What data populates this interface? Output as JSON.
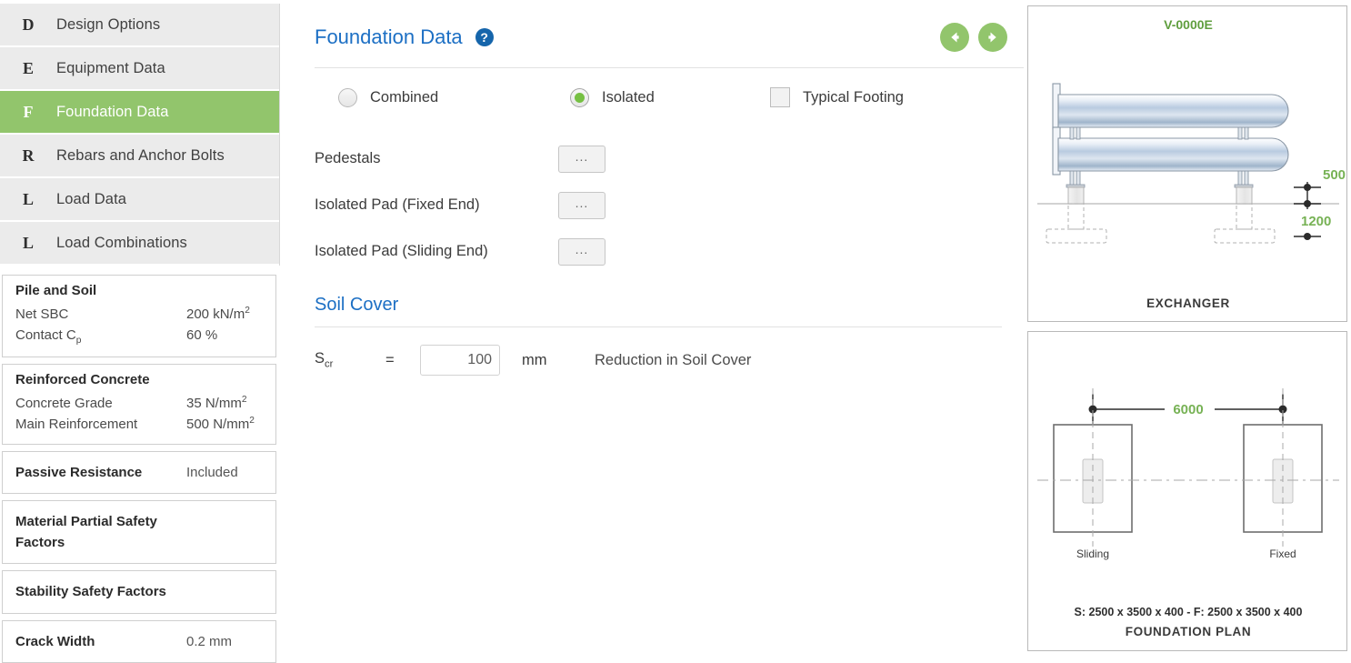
{
  "sidebar": {
    "nav_items": [
      {
        "key": "D",
        "label": "Design Options",
        "active": false
      },
      {
        "key": "E",
        "label": "Equipment Data",
        "active": false
      },
      {
        "key": "F",
        "label": "Foundation Data",
        "active": true
      },
      {
        "key": "R",
        "label": "Rebars and Anchor Bolts",
        "active": false
      },
      {
        "key": "L",
        "label": "Load Data",
        "active": false
      },
      {
        "key": "L",
        "label": "Load Combinations",
        "active": false
      }
    ],
    "cards": [
      {
        "title": "Pile and Soil",
        "rows": [
          {
            "key": "Net SBC",
            "value": "200 kN/m",
            "sup": "2"
          },
          {
            "key": "Contact C",
            "key_sub": "p",
            "value": "60 %",
            "sup": ""
          }
        ]
      },
      {
        "title": "Reinforced Concrete",
        "rows": [
          {
            "key": "Concrete Grade",
            "value": "35 N/mm",
            "sup": "2"
          },
          {
            "key": "Main Reinforcement",
            "value": "500 N/mm",
            "sup": "2"
          }
        ]
      }
    ],
    "compact_cards": [
      {
        "key": "Passive Resistance",
        "value": "Included"
      },
      {
        "key": "Material Partial Safety Factors",
        "value": ""
      },
      {
        "key": "Stability Safety Factors",
        "value": ""
      },
      {
        "key": "Crack Width",
        "value": "0.2 mm"
      }
    ]
  },
  "header": {
    "title": "Foundation Data",
    "help_icon": "question-mark-icon",
    "prev_label": "back-arrow-icon",
    "next_label": "forward-arrow-icon"
  },
  "options": {
    "combined": {
      "label": "Combined",
      "selected": false
    },
    "isolated": {
      "label": "Isolated",
      "selected": true
    },
    "typical_footing": {
      "label": "Typical Footing",
      "checked": false
    }
  },
  "fields": [
    {
      "label": "Pedestals",
      "button": "..."
    },
    {
      "label": "Isolated Pad (Fixed End)",
      "button": "..."
    },
    {
      "label": "Isolated Pad (Sliding End)",
      "button": "..."
    }
  ],
  "soil_cover": {
    "section_title": "Soil Cover",
    "symbol": "S",
    "symbol_sub": "cr",
    "equals": "=",
    "value": "100",
    "placeholder": "0",
    "unit": "mm",
    "description": "Reduction in Soil Cover"
  },
  "diagrams": {
    "elevation": {
      "tag": "V-0000E",
      "caption": "EXCHANGER",
      "dim_top": "500",
      "dim_bottom": "1200"
    },
    "plan": {
      "caption": "FOUNDATION PLAN",
      "span_dim": "6000",
      "left_label": "Sliding",
      "right_label": "Fixed",
      "sizes": "S: 2500 x 3500 x 400 - F: 2500 x 3500 x 400"
    }
  },
  "colors": {
    "accent_green": "#92c56c",
    "accent_blue": "#1c6fc4",
    "dim_green": "#77b255",
    "radio_green": "#76c043"
  }
}
